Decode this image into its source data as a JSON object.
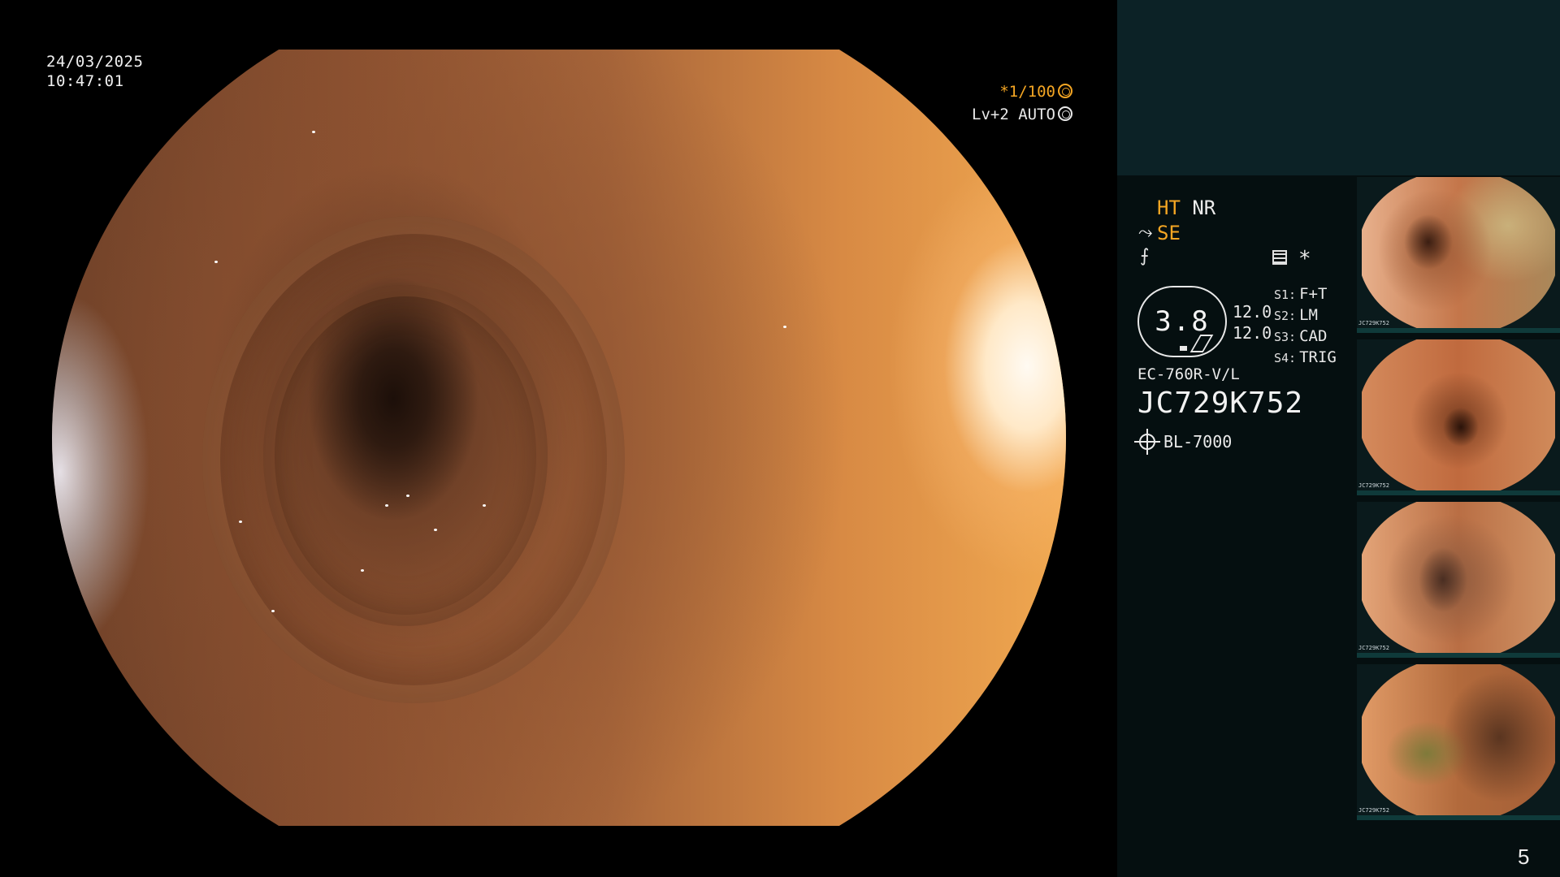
{
  "main_view": {
    "date": "24/03/2025",
    "time": "10:47:01",
    "shutter": "*1/100",
    "exposure": "Lv+2 AUTO"
  },
  "modes": {
    "ht": "HT",
    "nr": "NR",
    "se": "SE"
  },
  "processor": {
    "star": "*",
    "iris_value": "3.8",
    "gauge_values": [
      "12.0",
      "12.0"
    ],
    "switches": [
      {
        "key": "S1:",
        "value": "F+T"
      },
      {
        "key": "S2:",
        "value": "LM"
      },
      {
        "key": "S3:",
        "value": "CAD"
      },
      {
        "key": "S4:",
        "value": "TRIG"
      }
    ]
  },
  "scope": {
    "model": "EC-760R-V/L",
    "serial": "JC729K752",
    "light_source": "BL-7000"
  },
  "thumbnails": [
    {
      "serial": "JC729K752"
    },
    {
      "serial": "JC729K752"
    },
    {
      "serial": "JC729K752"
    },
    {
      "serial": "JC729K752"
    }
  ],
  "page_number": "5",
  "colors": {
    "accent_orange": "#f5a623",
    "panel_bg": "#050f10",
    "top_band_bg": "#0c2226"
  },
  "icons": {
    "shutter": "aperture-icon",
    "exposure": "target-icon",
    "light_source": "sun-icon",
    "record": "grid-icon"
  }
}
